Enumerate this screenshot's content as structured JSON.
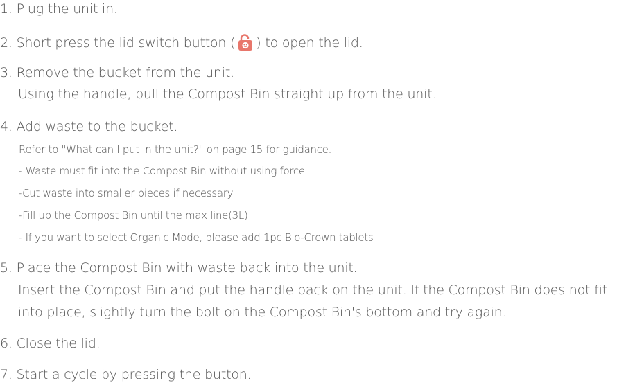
{
  "steps": {
    "s1": "1. Plug the unit in.",
    "s2_before": "2. Short press the lid switch button (",
    "s2_after": ") to open the lid.",
    "s3": "3. Remove the bucket from the unit.",
    "s3_detail": "Using the handle, pull the Compost Bin straight up from the unit.",
    "s4": "4. Add waste to the bucket.",
    "s4_ref": "Refer to \"What can I put in the unit?\" on page 15 for guidance.",
    "s4_b1": "- Waste must fit into the Compost Bin without using force",
    "s4_b2": "-Cut waste into smaller pieces if necessary",
    "s4_b3": "-Fill up the Compost Bin until the max line(3L)",
    "s4_b4": "- If you want to select Organic Mode, please add 1pc Bio-Crown tablets",
    "s5": "5. Place the Compost Bin with waste back into the unit.",
    "s5_detail_1": "Insert the Compost Bin and put the handle back on the unit. If the Compost Bin does not fit",
    "s5_detail_2": "into place, slightly turn the bolt on the Compost Bin's bottom and try again.",
    "s6": "6. Close the lid.",
    "s7": "7. Start a cycle by pressing the button."
  },
  "icon": {
    "name": "unlock-icon",
    "color": "#e8766b"
  }
}
